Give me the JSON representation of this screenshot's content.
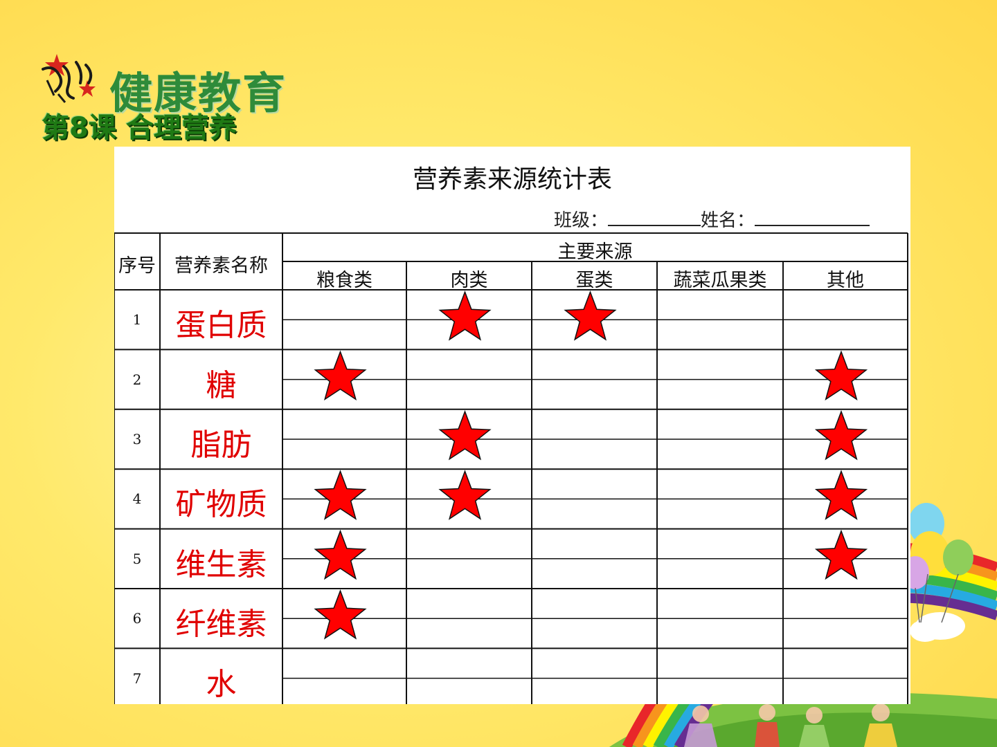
{
  "header": {
    "logo_title": "健康教育",
    "lesson_title": "第8课  合理营养"
  },
  "sheet": {
    "title": "营养素来源统计表",
    "class_label": "班级：",
    "name_label": "姓名：",
    "columns": {
      "index": "序号",
      "nutrient": "营养素名称",
      "group": "主要来源",
      "sources": [
        "粮食类",
        "肉类",
        "蛋类",
        "蔬菜瓜果类",
        "其他"
      ]
    },
    "rows": [
      {
        "index": "1",
        "nutrient": "蛋白质",
        "marks": [
          false,
          true,
          true,
          false,
          false
        ]
      },
      {
        "index": "2",
        "nutrient": "糖",
        "marks": [
          true,
          false,
          false,
          false,
          true
        ]
      },
      {
        "index": "3",
        "nutrient": "脂肪",
        "marks": [
          false,
          true,
          false,
          false,
          true
        ]
      },
      {
        "index": "4",
        "nutrient": "矿物质",
        "marks": [
          true,
          true,
          false,
          false,
          true
        ]
      },
      {
        "index": "5",
        "nutrient": "维生素",
        "marks": [
          true,
          false,
          false,
          false,
          true
        ]
      },
      {
        "index": "6",
        "nutrient": "纤维素",
        "marks": [
          true,
          false,
          false,
          false,
          false
        ]
      },
      {
        "index": "7",
        "nutrient": "水",
        "marks": [
          false,
          false,
          false,
          false,
          false
        ]
      }
    ]
  },
  "colors": {
    "background": "#ffe96b",
    "nutrient_text": "#e00000",
    "star_fill": "#ff0000",
    "title_green": "#2e8b3a"
  },
  "icons": [
    "star-icon",
    "balloon-icon",
    "rainbow-icon"
  ]
}
